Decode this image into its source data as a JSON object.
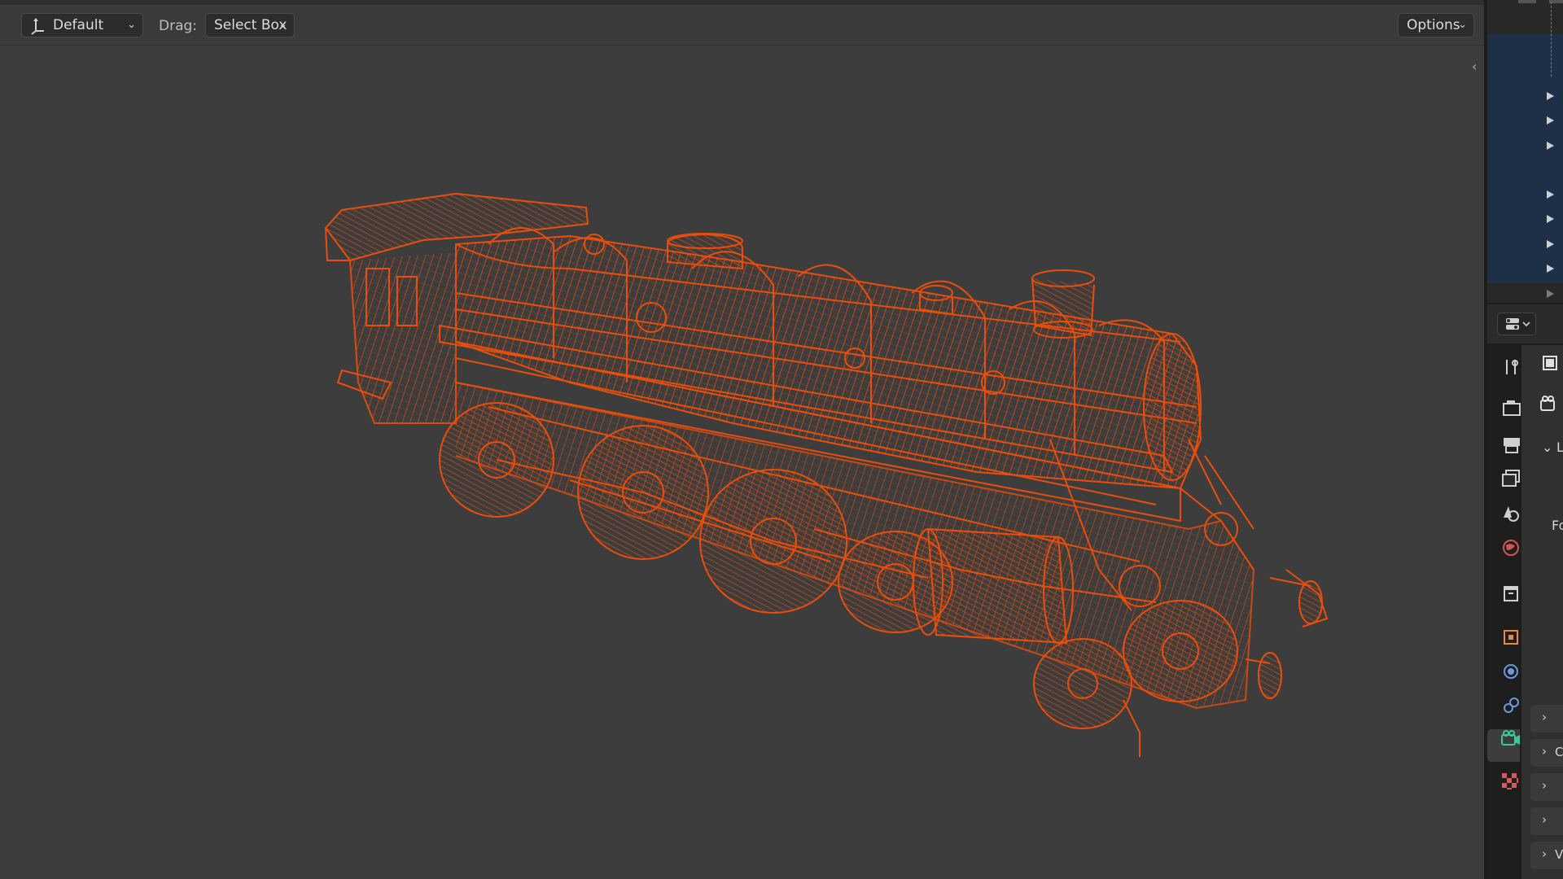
{
  "header": {
    "orientation_label": "Default",
    "drag_label": "Drag:",
    "drag_mode": "Select Box",
    "options_label": "Options"
  },
  "icons": {
    "orientation": "transform-orientation-icon",
    "collapse": "chevron-left-icon",
    "property_tabs": [
      "tool-icon",
      "render-icon",
      "output-icon",
      "view-layer-icon",
      "scene-icon",
      "world-icon",
      "collection-icon",
      "object-icon",
      "physics-icon",
      "constraints-icon",
      "object-data-camera-icon",
      "texture-icon"
    ]
  },
  "colors": {
    "wire_selected": "#e84e0c",
    "viewport_bg": "#3d3d3d",
    "outliner_selected": "#1e2f48"
  },
  "properties": {
    "visible_fragments": [
      "L",
      "Fo",
      "C",
      "V"
    ]
  }
}
